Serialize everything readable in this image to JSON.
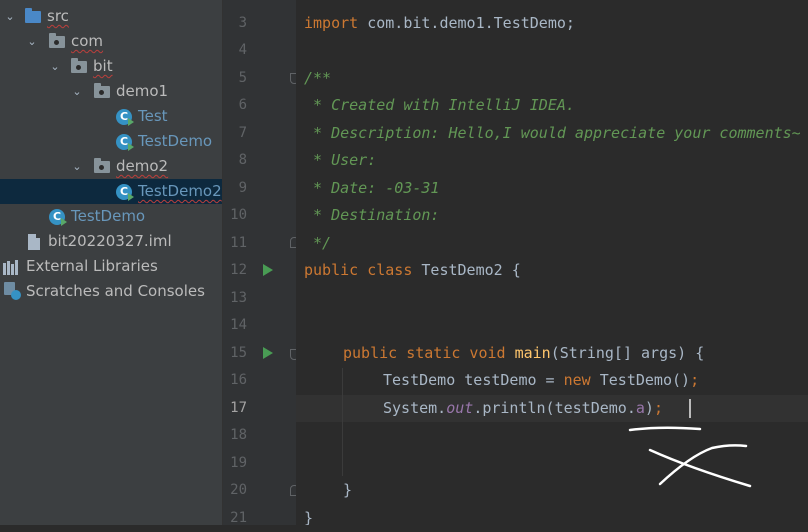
{
  "project_tree": {
    "items": [
      {
        "label": "src",
        "kind": "folder-src"
      },
      {
        "label": "com",
        "kind": "package"
      },
      {
        "label": "bit",
        "kind": "package"
      },
      {
        "label": "demo1",
        "kind": "package"
      },
      {
        "label": "Test",
        "kind": "class"
      },
      {
        "label": "TestDemo",
        "kind": "class"
      },
      {
        "label": "demo2",
        "kind": "package"
      },
      {
        "label": "TestDemo2",
        "kind": "class",
        "selected": true
      },
      {
        "label": "TestDemo",
        "kind": "class"
      },
      {
        "label": "bit20220327.iml",
        "kind": "module-file"
      },
      {
        "label": "External Libraries",
        "kind": "libraries"
      },
      {
        "label": "Scratches and Consoles",
        "kind": "scratches"
      }
    ]
  },
  "editor": {
    "line_numbers": [
      "3",
      "4",
      "5",
      "6",
      "7",
      "8",
      "9",
      "10",
      "11",
      "12",
      "13",
      "14",
      "15",
      "16",
      "17",
      "18",
      "19",
      "20",
      "21"
    ],
    "current_line": "17",
    "code": {
      "l3_kw": "import",
      "l3_rest": " com.bit.demo1.TestDemo;",
      "l5": "/**",
      "l6": " * Created with IntelliJ IDEA.",
      "l7": " * Description: Hello,I would appreciate your comments~",
      "l8": " * User:",
      "l9": " * Date: -03-31",
      "l10": " * Destination:",
      "l11": " */",
      "l12_kw": "public class",
      "l12_rest": " TestDemo2 {",
      "l15_kw": "public static void",
      "l15_fn": "main",
      "l15_rest": "(String[] args) {",
      "l16_a": "TestDemo testDemo = ",
      "l16_kw": "new",
      "l16_b": " TestDemo()",
      "l16_semi": ";",
      "l17_a": "System.",
      "l17_out": "out",
      "l17_b": ".println(testDemo.",
      "l17_fld": "a",
      "l17_c": ")",
      "l17_semi": ";",
      "l20": "}",
      "l21": "}"
    }
  },
  "colors": {
    "keyword": "#cc7832",
    "comment": "#629755",
    "function": "#ffc66d",
    "field": "#9876aa",
    "error_squiggle": "#bc3f3c"
  },
  "icons": [
    "folder-icon",
    "package-icon",
    "class-icon",
    "module-file-icon",
    "libraries-icon",
    "scratches-icon",
    "run-gutter-icon",
    "fold-marker-icon"
  ]
}
